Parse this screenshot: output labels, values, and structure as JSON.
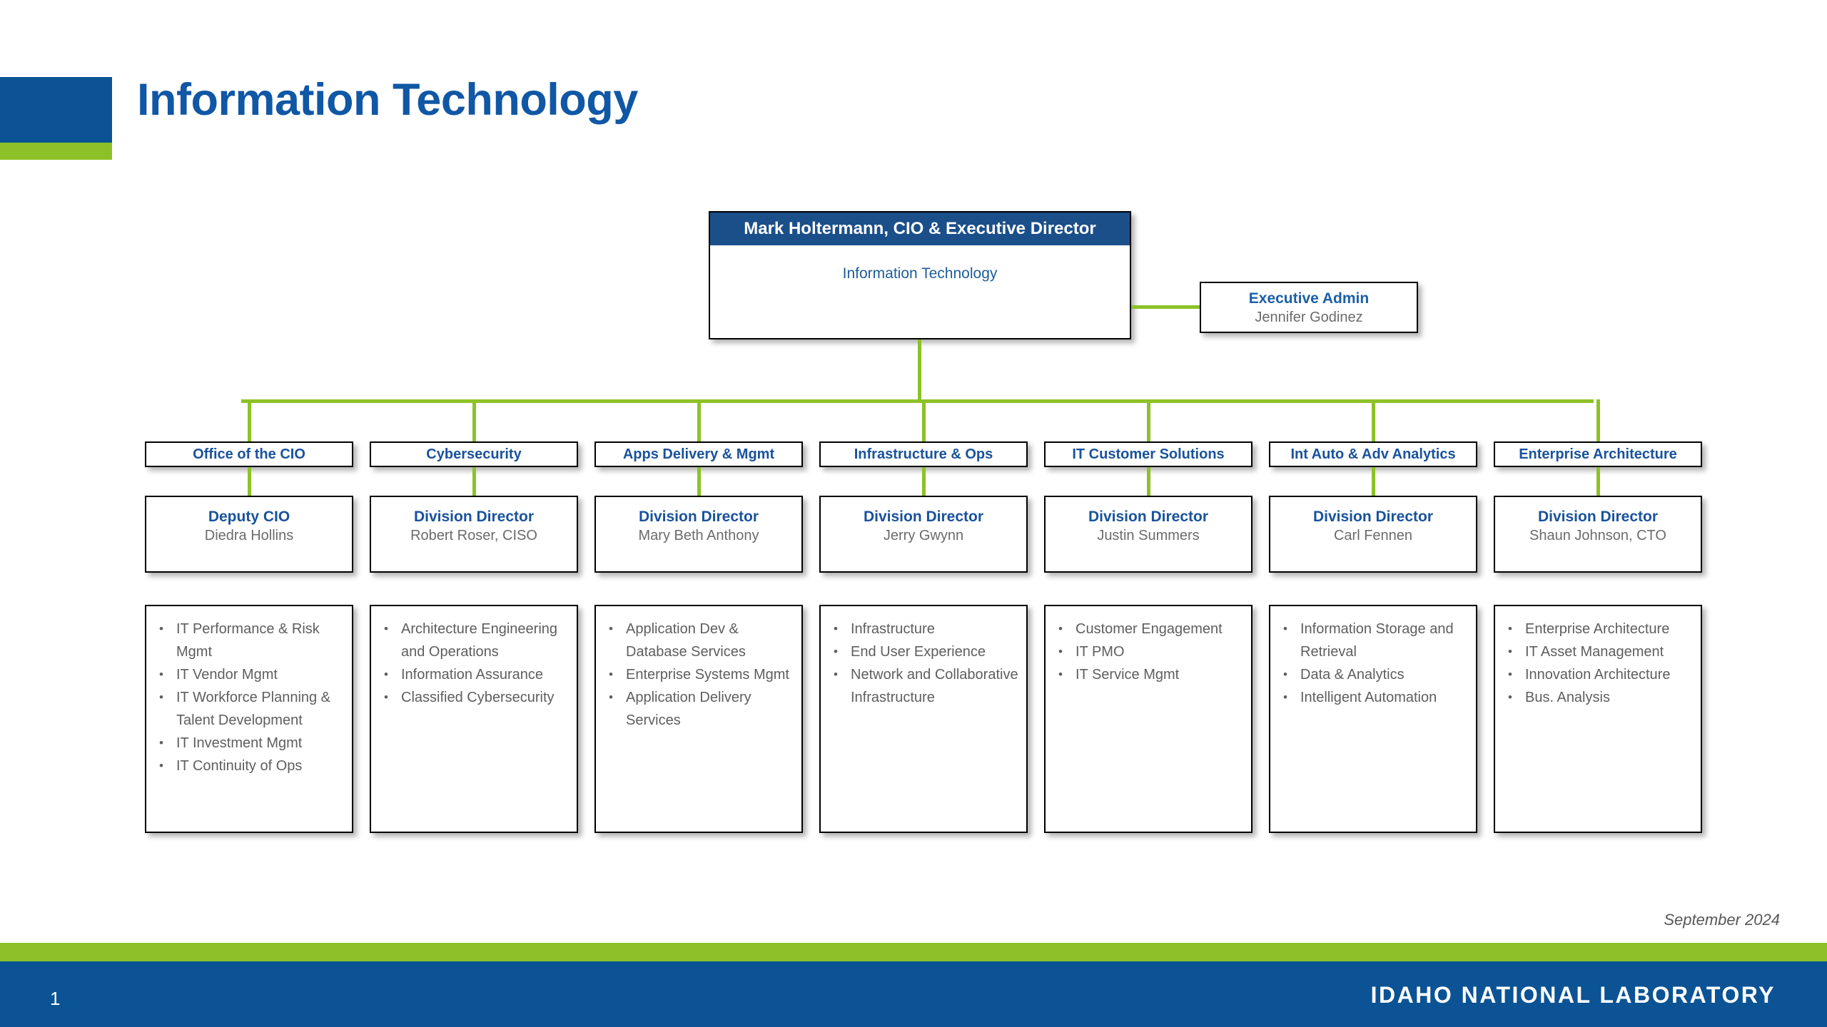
{
  "slide": {
    "title": "Information Technology",
    "date": "September 2024",
    "page_number": "1",
    "organization": "IDAHO NATIONAL LABORATORY",
    "colors": {
      "brand_blue": "#0B5394",
      "brand_green": "#8CC227",
      "header_blue": "#1B4F8A",
      "text_blue": "#19529C",
      "text_gray": "#5E5E5E"
    }
  },
  "executive": {
    "name_title": "Mark Holtermann, CIO & Executive Director",
    "organization": "Information Technology"
  },
  "executive_admin": {
    "role": "Executive Admin",
    "person": "Jennifer Godinez"
  },
  "departments": [
    {
      "header": "Office of the CIO",
      "role": "Deputy CIO",
      "person": "Diedra Hollins",
      "functions": [
        "IT Performance & Risk Mgmt",
        "IT Vendor Mgmt",
        "IT Workforce Planning & Talent Development",
        "IT Investment Mgmt",
        "IT Continuity of Ops"
      ]
    },
    {
      "header": "Cybersecurity",
      "role": "Division Director",
      "person": "Robert Roser, CISO",
      "functions": [
        "Architecture Engineering and Operations",
        "Information Assurance",
        "Classified Cybersecurity"
      ]
    },
    {
      "header": "Apps Delivery & Mgmt",
      "role": "Division Director",
      "person": "Mary Beth Anthony",
      "functions": [
        "Application Dev & Database Services",
        "Enterprise Systems Mgmt",
        "Application Delivery Services"
      ]
    },
    {
      "header": "Infrastructure & Ops",
      "role": "Division Director",
      "person": "Jerry Gwynn",
      "functions": [
        "Infrastructure",
        "End User Experience",
        "Network and Collaborative Infrastructure"
      ]
    },
    {
      "header": "IT Customer Solutions",
      "role": "Division Director",
      "person": "Justin Summers",
      "functions": [
        "Customer Engagement",
        "IT PMO",
        "IT Service Mgmt"
      ]
    },
    {
      "header": "Int Auto & Adv Analytics",
      "role": "Division Director",
      "person": "Carl Fennen",
      "functions": [
        "Information Storage and Retrieval",
        "Data & Analytics",
        "Intelligent Automation"
      ]
    },
    {
      "header": "Enterprise Architecture",
      "role": "Division Director",
      "person": "Shaun Johnson, CTO",
      "functions": [
        "Enterprise Architecture",
        "IT Asset Management",
        "Innovation Architecture",
        "Bus. Analysis"
      ]
    }
  ]
}
